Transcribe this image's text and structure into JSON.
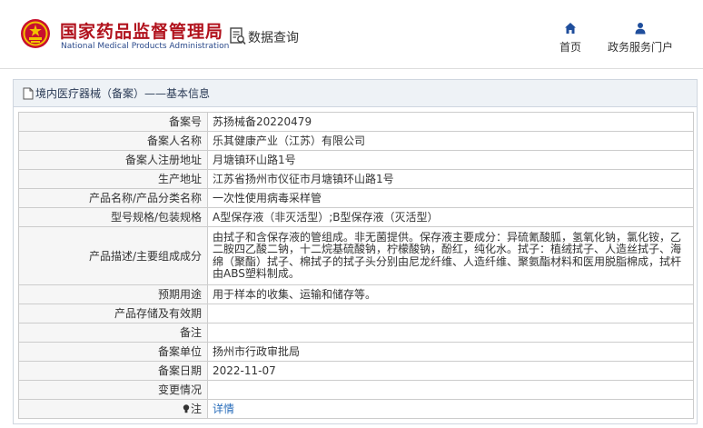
{
  "header": {
    "agency_name": "国家药品监督管理局",
    "agency_name_en": "National Medical Products Administration",
    "query_label": "数据查询",
    "nav": [
      {
        "label": "首页",
        "icon": "home-icon"
      },
      {
        "label": "政务服务门户",
        "icon": "user-icon"
      }
    ]
  },
  "panel": {
    "title": "境内医疗器械（备案）——基本信息"
  },
  "details": [
    {
      "label": "备案号",
      "value": "苏扬械备20220479"
    },
    {
      "label": "备案人名称",
      "value": "乐其健康产业（江苏）有限公司"
    },
    {
      "label": "备案人注册地址",
      "value": "月塘镇环山路1号"
    },
    {
      "label": "生产地址",
      "value": "江苏省扬州市仪征市月塘镇环山路1号"
    },
    {
      "label": "产品名称/产品分类名称",
      "value": "一次性使用病毒采样管"
    },
    {
      "label": "型号规格/包装规格",
      "value": "A型保存液（非灭活型）;B型保存液（灭活型）"
    },
    {
      "label": "产品描述/主要组成成分",
      "value": "由拭子和含保存液的管组成。非无菌提供。保存液主要成分：异硫氰酸胍，氢氧化钠，氯化铵，乙二胺四乙酸二钠，十二烷基硫酸钠，柠檬酸钠，酚红，纯化水。拭子：植绒拭子、人造丝拭子、海绵（聚酯）拭子、棉拭子的拭子头分别由尼龙纤维、人造纤维、聚氨酯材料和医用脱脂棉成，拭杆由ABS塑料制成。"
    },
    {
      "label": "预期用途",
      "value": "用于样本的收集、运输和储存等。"
    },
    {
      "label": "产品存储及有效期",
      "value": ""
    },
    {
      "label": "备注",
      "value": ""
    },
    {
      "label": "备案单位",
      "value": "扬州市行政审批局"
    },
    {
      "label": "备案日期",
      "value": "2022-11-07"
    },
    {
      "label": "变更情况",
      "value": ""
    },
    {
      "label": "注",
      "value": "详情",
      "icon": "lightbulb-icon"
    }
  ],
  "colors": {
    "brand_red": "#b1121d",
    "brand_blue": "#2b4a8b",
    "link": "#2a6ebb",
    "label_bg": "#f6f6f6",
    "panel_head_bg": "#eef2f6"
  }
}
